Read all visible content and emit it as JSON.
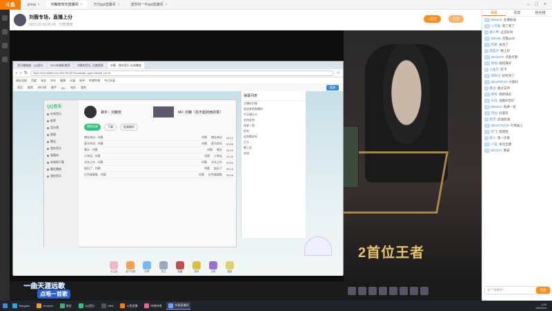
{
  "app": {
    "logo": "斗鱼"
  },
  "topbar": {
    "tabs": [
      {
        "label": "jinnaj",
        "active": false
      },
      {
        "label": "刘薇安欢乐直播间",
        "active": true
      },
      {
        "label": "万元ppt直播间",
        "active": false
      },
      {
        "label": "送你的一半ppt直播间",
        "active": false
      }
    ]
  },
  "header": {
    "title": "刘薇专场，直播上分",
    "meta": "2022.02.04 06:49  ·  分类游戏",
    "follow_label": "+关注",
    "share_label": "分享"
  },
  "browser": {
    "tabs": [
      {
        "label": "音乐播放器 - QQ音乐",
        "active": false
      },
      {
        "label": "2022年精彩推荐",
        "active": false
      },
      {
        "label": "刘薇的音乐_百度搜索",
        "active": false
      },
      {
        "label": "刘薇 - 我的音乐 在线播放",
        "active": true
      }
    ],
    "address": "https://live.bilibili.com/22278718?broadcast_type=0&visit_id=1s",
    "bookmarks": [
      "网址导航",
      "百度",
      "淘宝",
      "京东",
      "微博",
      "天猫",
      "知乎",
      "哔哩哔哩",
      "今日头条"
    ],
    "nav": [
      "首页",
      "推荐",
      "排行榜",
      "歌手",
      "MV",
      "电台",
      "我的"
    ],
    "login": "登录"
  },
  "music": {
    "app_name": "QQ音乐",
    "sidebar": [
      "在线音乐",
      "推荐",
      "音乐馆",
      "视频",
      "雷达",
      "我的音乐",
      "我喜欢",
      "本地和下载",
      "最近播放",
      "我的音乐"
    ],
    "song_title": "歌手：刘薇安",
    "mv_title": "MV: 刘薇（花不起的雨的季）",
    "play_all": "播放全部",
    "download": "下载",
    "add": "批量操作",
    "rows": [
      {
        "name": "想去海边 - 刘薇",
        "artist": "刘薇",
        "album": "想去海边",
        "time": "04:12"
      },
      {
        "name": "夏天的风 - 刘薇",
        "artist": "刘薇",
        "album": "夏天的风",
        "time": "03:45"
      },
      {
        "name": "晴天 - 刘薇",
        "artist": "刘薇",
        "album": "晴天",
        "time": "04:29"
      },
      {
        "name": "小幸运 - 刘薇",
        "artist": "刘薇",
        "album": "小幸运",
        "time": "04:25"
      },
      {
        "name": "光年之外 - 刘薇",
        "artist": "刘薇",
        "album": "光年之外",
        "time": "03:55"
      },
      {
        "name": "起风了 - 刘薇",
        "artist": "刘薇",
        "album": "起风了",
        "time": "05:13"
      },
      {
        "name": "红色高跟鞋 - 刘薇",
        "artist": "刘薇",
        "album": "红色高跟鞋",
        "time": "03:26"
      }
    ],
    "dock": [
      "小主页",
      "送个礼物",
      "分享",
      "关注",
      "收藏",
      "投币",
      "点赞",
      "更多"
    ]
  },
  "inner_chat": {
    "header": "弹幕列表",
    "lines": [
      "主播好厉害",
      "欢迎来到直播间",
      "今天唱什么",
      "支持支持",
      "再来一首",
      "好听",
      "这首歌好听",
      "打卡",
      "晚上好",
      "加油"
    ]
  },
  "stream": {
    "champion_text": "2首位王者",
    "bottom_title": "一曲天涯远歌",
    "bottom_sub": "点唱一首歌"
  },
  "chat": {
    "tabs": [
      "弹幕",
      "贵宾",
      "粉丝榜"
    ],
    "messages": [
      {
        "lvl": "22",
        "name": "bili6322",
        "text": "主播加油"
      },
      {
        "lvl": "18",
        "name": "小可爱",
        "text": "来了来了"
      },
      {
        "lvl": "9",
        "name": "路人甲",
        "text": "这首好听"
      },
      {
        "lvl": "31",
        "name": "bilibili6",
        "text": "刘薇yyds"
      },
      {
        "lvl": "12",
        "name": "阿星",
        "text": "关注了"
      },
      {
        "lvl": "5",
        "name": "夜猫子",
        "text": "晚上好"
      },
      {
        "lvl": "27",
        "name": "bili22278",
        "text": "点歌点歌"
      },
      {
        "lvl": "14",
        "name": "听雨",
        "text": "唱得真好"
      },
      {
        "lvl": "8",
        "name": "小鱼干",
        "text": "打卡"
      },
      {
        "lvl": "19",
        "name": "风吹过",
        "text": "好听哭了"
      },
      {
        "lvl": "33",
        "name": "bili2278718",
        "text": "大家好"
      },
      {
        "lvl": "6",
        "name": "路过",
        "text": "路过支持"
      },
      {
        "lvl": "21",
        "name": "青柠",
        "text": "想听晴天"
      },
      {
        "lvl": "11",
        "name": "大白",
        "text": "主播声音好"
      },
      {
        "lvl": "16",
        "name": "bili6322",
        "text": "再来一首"
      },
      {
        "lvl": "25",
        "name": "月光",
        "text": "好喜欢"
      },
      {
        "lvl": "7",
        "name": "星河",
        "text": "加油加油"
      },
      {
        "lvl": "29",
        "name": "bili22278718",
        "text": "礼物送上"
      },
      {
        "lvl": "13",
        "name": "阿飞",
        "text": "哈哈哈"
      },
      {
        "lvl": "4",
        "name": "新人",
        "text": "第一次来"
      },
      {
        "lvl": "17",
        "name": "小蓝",
        "text": "关注主播"
      },
      {
        "lvl": "23",
        "name": "bili2227",
        "text": "晚安"
      }
    ],
    "input_placeholder": "发个弹幕吧~",
    "send_label": "发送"
  },
  "taskbar": {
    "items": [
      "Telegram",
      "Chrome",
      "微信",
      "QQ音乐",
      "OBS",
      "斗鱼直播",
      "哔哩哔哩",
      "刘薇直播间"
    ],
    "clock_time": "1:00",
    "clock_date": "2022/2/4"
  },
  "colors": {
    "accent": "#ff7a00",
    "chat_name": "#3a8be0",
    "music_green": "#31c27c"
  }
}
